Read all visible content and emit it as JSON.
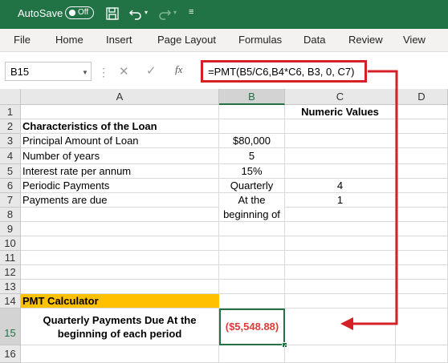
{
  "titlebar": {
    "autosave_label": "AutoSave",
    "toggle_state": "Off"
  },
  "menu": [
    "File",
    "Home",
    "Insert",
    "Page Layout",
    "Formulas",
    "Data",
    "Review",
    "View"
  ],
  "formula_bar": {
    "name_box": "B15",
    "formula": "=PMT(B5/C6,B4*C6, B3, 0, C7)",
    "fx": "fx"
  },
  "columns": [
    "A",
    "B",
    "C",
    "D"
  ],
  "rows": [
    "1",
    "2",
    "3",
    "4",
    "5",
    "6",
    "7",
    "8",
    "9",
    "10",
    "11",
    "12",
    "13",
    "14",
    "15",
    "16"
  ],
  "cells": {
    "c1": "Numeric Values",
    "a2": "Characteristics of the Loan",
    "a3": "Principal Amount of Loan",
    "b3": "$80,000",
    "a4": "Number of years",
    "b4": "5",
    "a5": "Interest rate per annum",
    "b5": "15%",
    "a6": "Periodic Payments",
    "b6": "Quarterly",
    "c6": "4",
    "a7": "Payments are due",
    "b7_line1": "At the",
    "b7_line2": "beginning of",
    "c7": "1",
    "a14": "PMT Calculator",
    "a15_line1": "Quarterly Payments Due At the",
    "a15_line2": "beginning of each period",
    "b15": "($5,548.88)"
  },
  "colors": {
    "excel_green": "#217346",
    "highlight_yellow": "#ffc000",
    "annotation_red": "#d62027",
    "negative_red": "#e03b3b"
  }
}
